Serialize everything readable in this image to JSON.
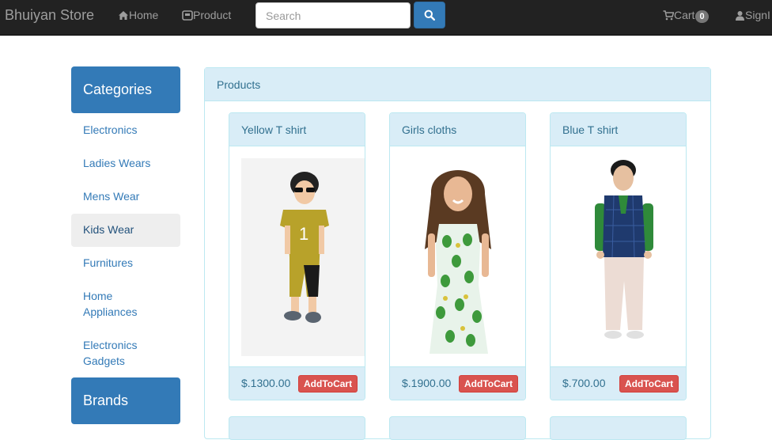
{
  "navbar": {
    "brand": "Bhuiyan Store",
    "home_label": "Home",
    "product_label": "Product",
    "search_placeholder": "Search",
    "cart_label": "Cart",
    "cart_count": "0",
    "signin_label": "SignI"
  },
  "sidebar": {
    "categories_title": "Categories",
    "items": [
      {
        "label": "Electronics"
      },
      {
        "label": "Ladies Wears"
      },
      {
        "label": "Mens Wear"
      },
      {
        "label": "Kids Wear",
        "active": true
      },
      {
        "label": "Furnitures"
      },
      {
        "label": "Home Appliances"
      },
      {
        "label": "Electronics Gadgets"
      }
    ],
    "brands_title": "Brands"
  },
  "products": {
    "panel_title": "Products",
    "add_label": "AddToCart",
    "items": [
      {
        "name": "Yellow T shirt",
        "price": "$.1300.00",
        "image": "boy-yellow-outfit"
      },
      {
        "name": "Girls cloths",
        "price": "$.1900.00",
        "image": "girl-leaf-print-dress"
      },
      {
        "name": "Blue T shirt",
        "price": "$.700.00",
        "image": "boy-blue-vest"
      }
    ]
  },
  "colors": {
    "navbar_bg": "#222222",
    "primary": "#337ab7",
    "info_bg": "#d9edf7",
    "info_border": "#bce8f1",
    "danger": "#d9534f"
  }
}
